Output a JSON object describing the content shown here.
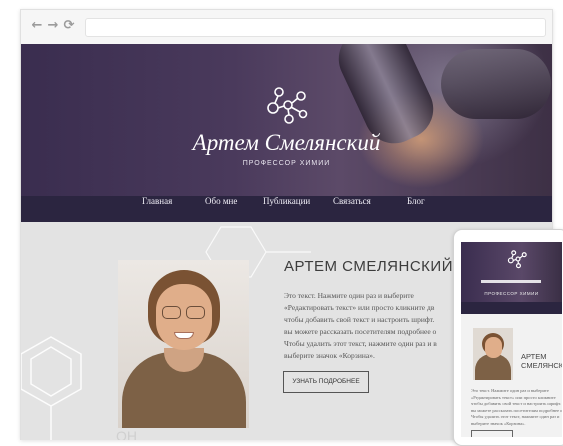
{
  "browser": {
    "nav": {
      "back_icon": "←",
      "forward_icon": "→",
      "reload_icon": "⟳"
    },
    "address_value": ""
  },
  "site": {
    "hero": {
      "title": "Артем Смелянский",
      "subtitle": "ПРОФЕССОР ХИМИИ",
      "logo_icon": "molecule-icon"
    },
    "menu": [
      "Главная",
      "Обо мне",
      "Публикации",
      "Связаться",
      "Блог"
    ],
    "profile": {
      "name": "АРТЕМ СМЕЛЯНСКИЙ",
      "bio_lines": [
        "Это текст. Нажмите один раз и выберите",
        "«Редактировать текст» или просто кликните дв",
        "чтобы добавить свой текст и настроить шрифт.",
        "вы можете рассказать посетителям подробнее о",
        "Чтобы удалить этот текст, нажмите один раз и в",
        "выберите значок «Корзина»."
      ],
      "button_label": "УЗНАТЬ ПОДРОБНЕЕ",
      "chem_label": "OH"
    }
  },
  "tablet": {
    "hero_subtitle": "ПРОФЕССОР ХИМИИ",
    "name_line1": "АРТЕМ",
    "name_line2": "СМЕЛЯНСКИЙ",
    "bio_lines": [
      "Это текст. Нажмите один раз и выберите",
      "«Редактировать текст» или просто кликните",
      "чтобы добавить свой текст и настроить шрифт.",
      "вы можете рассказать посетителям подробнее о",
      "Чтобы удалить этот текст, нажмите один раз и",
      "выберите значок «Корзина»."
    ]
  },
  "colors": {
    "hero_dark": "#3a2d4f",
    "menu_bg": "#2b2540",
    "content_bg": "#e3e3e3",
    "text": "#3c3c3c"
  }
}
